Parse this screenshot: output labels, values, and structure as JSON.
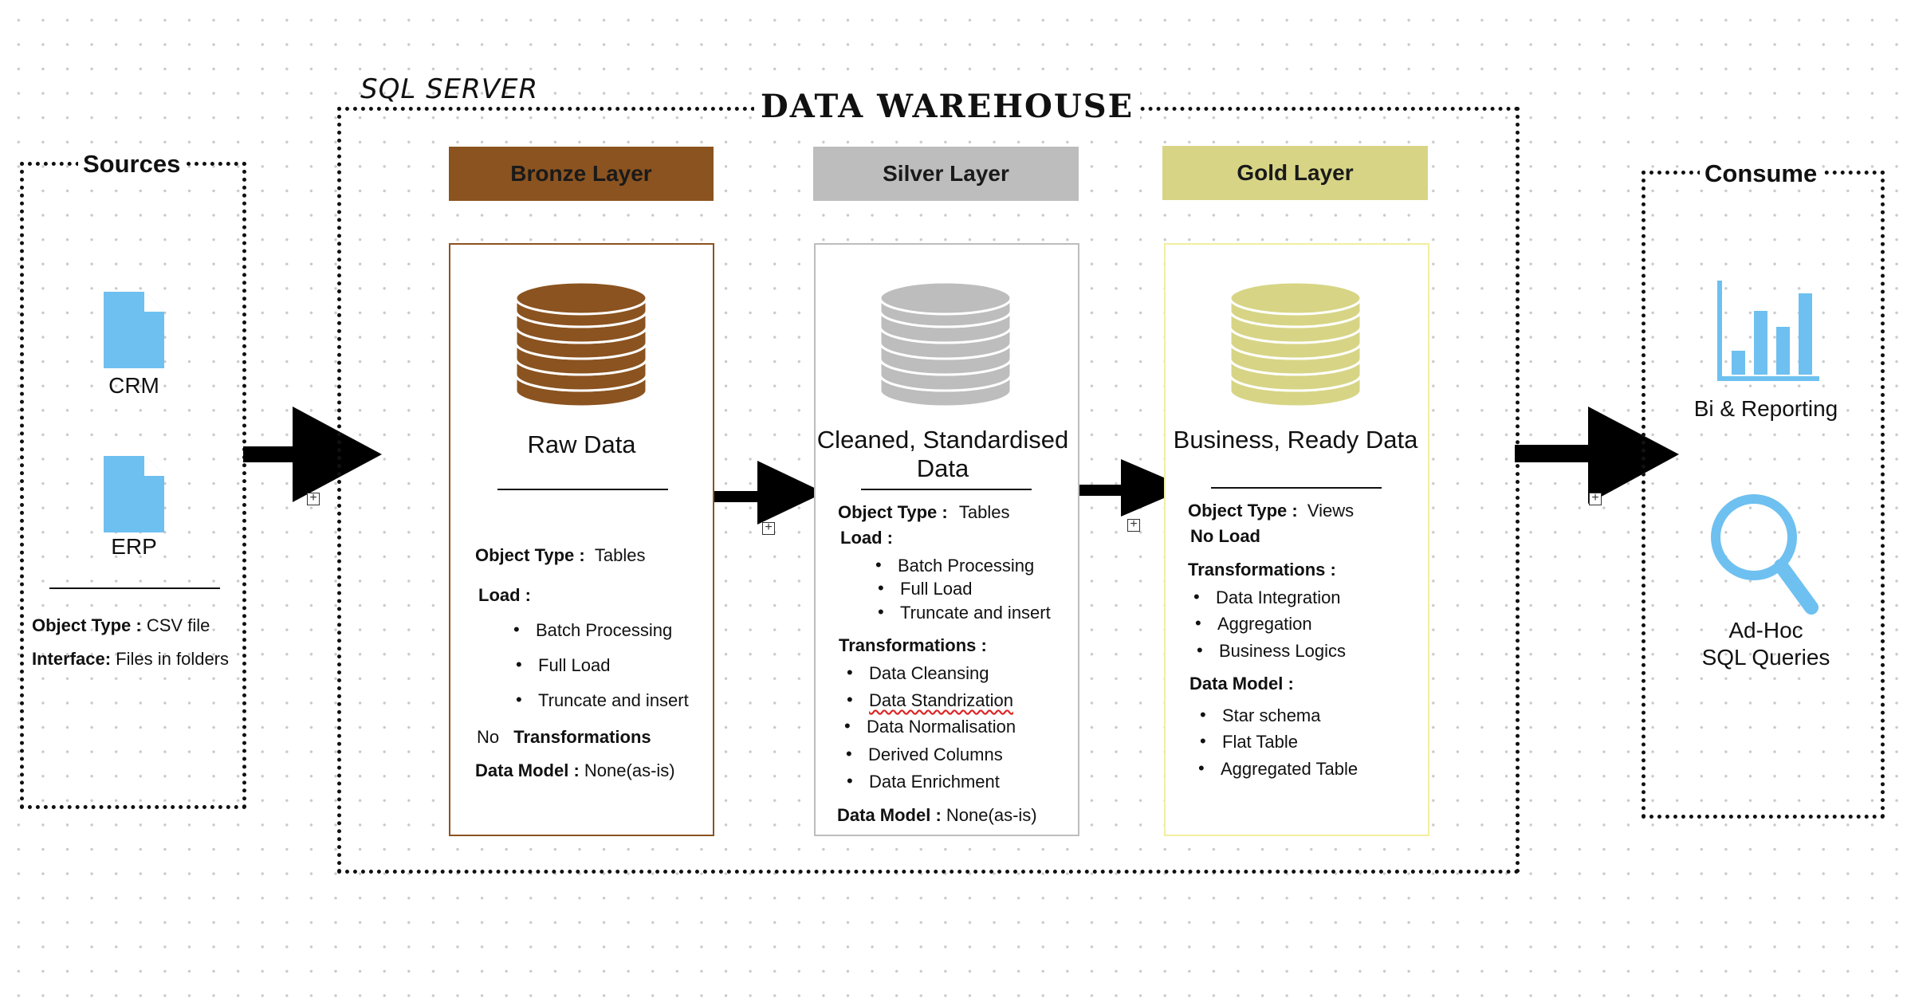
{
  "sources": {
    "title": "Sources",
    "crm_label": "CRM",
    "erp_label": "ERP",
    "object_type_label": "Object Type :",
    "object_type_value": "CSV file",
    "interface_label": "Interface:",
    "interface_value": "Files in folders"
  },
  "warehouse": {
    "server_label": "SQL SERVER",
    "title": "DATA WAREHOUSE"
  },
  "bronze": {
    "header": "Bronze Layer",
    "color": "#8B5320",
    "description": "Raw Data",
    "object_type_label": "Object Type :",
    "object_type_value": "Tables",
    "load_label": "Load :",
    "load_items": [
      "Batch Processing",
      "Full Load",
      "Truncate and insert"
    ],
    "no_prefix": "No",
    "transformations_label": "Transformations",
    "data_model_label": "Data Model :",
    "data_model_value": "None(as-is)"
  },
  "silver": {
    "header": "Silver Layer",
    "color": "#BDBDBD",
    "description_line1": "Cleaned, Standardised",
    "description_line2": "Data",
    "object_type_label": "Object Type :",
    "object_type_value": "Tables",
    "load_label": "Load :",
    "load_items": [
      "Batch Processing",
      "Full Load",
      "Truncate and insert"
    ],
    "transformations_label": "Transformations :",
    "transformation_items": [
      "Data Cleansing",
      "Data Standrization",
      "Data Normalisation",
      "Derived Columns",
      "Data Enrichment"
    ],
    "data_model_label": "Data Model :",
    "data_model_value": "None(as-is)"
  },
  "gold": {
    "header": "Gold Layer",
    "color": "#D7D585",
    "description": "Business, Ready Data",
    "object_type_label": "Object Type :",
    "object_type_value": "Views",
    "no_load_label": "No Load",
    "transformations_label": "Transformations :",
    "transformation_items": [
      "Data Integration",
      "Aggregation",
      "Business Logics"
    ],
    "data_model_label": "Data Model :",
    "data_model_items": [
      "Star schema",
      "Flat Table",
      "Aggregated Table"
    ]
  },
  "consume": {
    "title": "Consume",
    "bi_label": "Bi & Reporting",
    "adhoc_line1": "Ad-Hoc",
    "adhoc_line2": "SQL Queries",
    "icon_color": "#6EC0F0"
  },
  "icons": {
    "source_file": "document-icon",
    "database": "database-icon",
    "bar_chart": "bar-chart-icon",
    "search": "magnifier-icon",
    "arrow": "right-arrow-icon"
  }
}
